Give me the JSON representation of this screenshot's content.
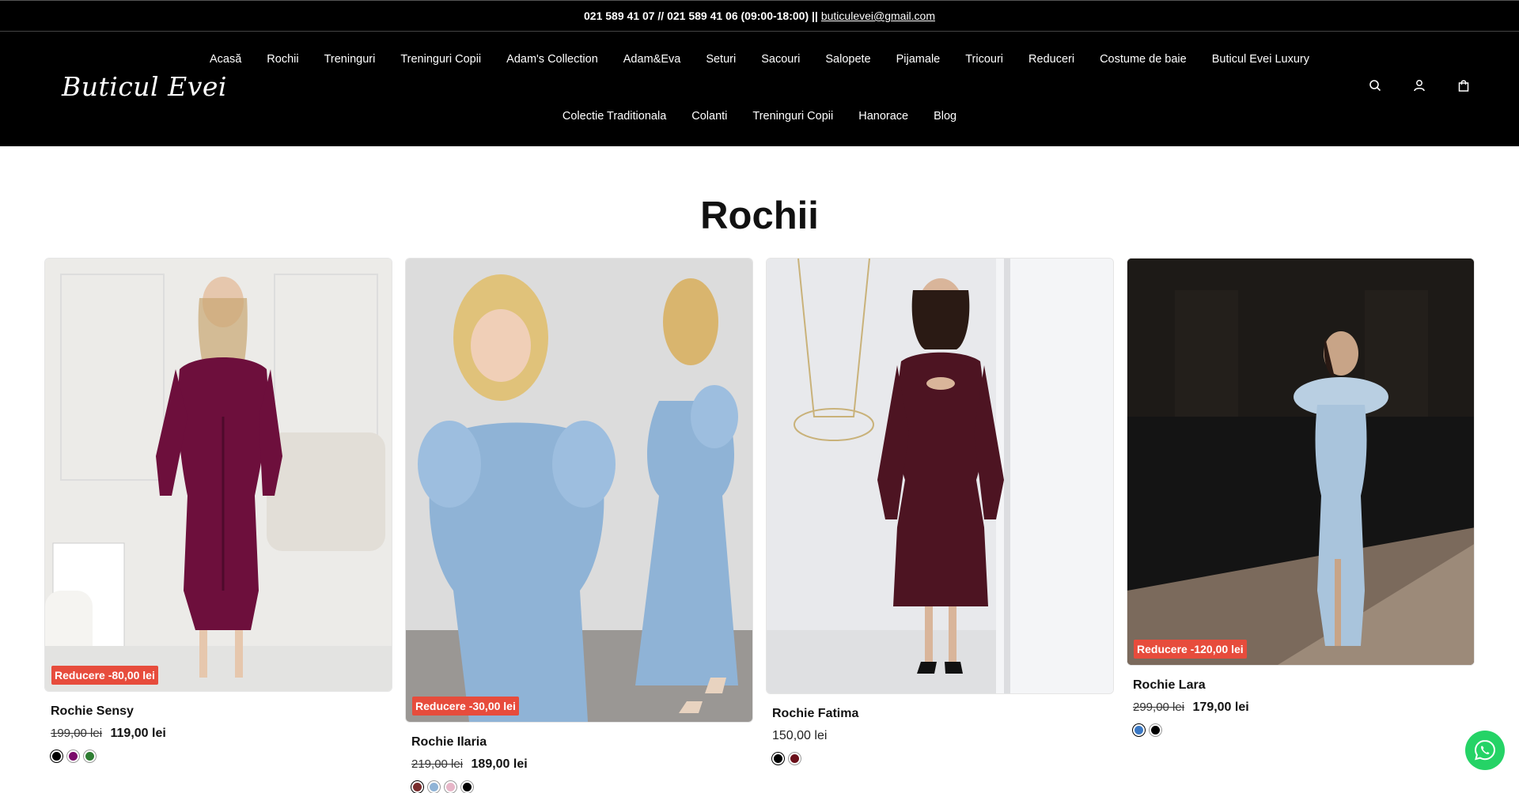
{
  "topbar": {
    "phones": "021 589 41 07 // 021 589 41 06 (09:00-18:00) ||",
    "email": "buticulevei@gmail.com"
  },
  "header": {
    "logo": "Buticul Evei",
    "nav_row1": [
      "Acasă",
      "Rochii",
      "Treninguri",
      "Treninguri Copii",
      "Adam's Collection",
      "Adam&Eva",
      "Seturi",
      "Sacouri",
      "Salopete",
      "Pijamale",
      "Tricouri",
      "Reduceri",
      "Costume de baie",
      "Buticul Evei Luxury"
    ],
    "nav_row2": [
      "Colectie Traditionala",
      "Colanti",
      "Treninguri Copii",
      "Hanorace",
      "Blog"
    ],
    "icons": [
      "search-icon",
      "account-icon",
      "cart-icon"
    ]
  },
  "page_title": "Rochii",
  "products": [
    {
      "name": "Rochie Sensy",
      "badge": "Reducere -80,00 lei",
      "old_price": "199,00 lei",
      "price": "119,00 lei",
      "swatches": [
        "#000000",
        "#7a0a6a",
        "#2e7d32"
      ],
      "image": {
        "bg": "#ecebe8",
        "dress": "#6d0f3c"
      }
    },
    {
      "name": "Rochie Ilaria",
      "badge": "Reducere -30,00 lei",
      "old_price": "219,00 lei",
      "price": "189,00 lei",
      "swatches": [
        "#7a2e2e",
        "#8fb3d6",
        "#e7b6c8",
        "#000000"
      ],
      "image": {
        "bg": "#dcdcdc",
        "dress": "#8fb3d6"
      }
    },
    {
      "name": "Rochie Fatima",
      "badge": "",
      "old_price": "",
      "price": "150,00 lei",
      "swatches": [
        "#000000",
        "#6b0f1a"
      ],
      "image": {
        "bg": "#e8e9ec",
        "dress": "#4d1422"
      }
    },
    {
      "name": "Rochie Lara",
      "badge": "Reducere -120,00 lei",
      "old_price": "299,00 lei",
      "price": "179,00 lei",
      "swatches": [
        "#3a78c4",
        "#000000"
      ],
      "image": {
        "bg": "#141414",
        "dress": "#a9c4dc"
      }
    }
  ],
  "colors": {
    "header_bg": "#000000",
    "badge": "#e74c3c",
    "whatsapp": "#25d366"
  }
}
